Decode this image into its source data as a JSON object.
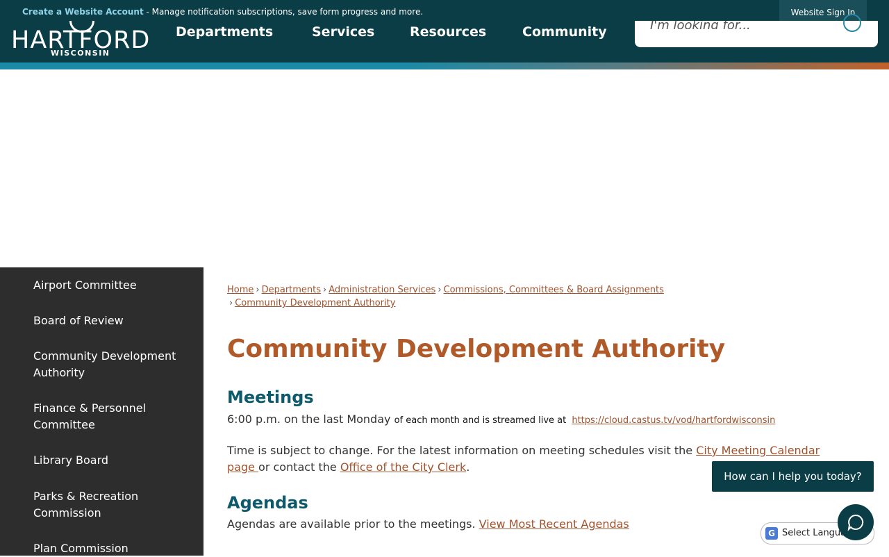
{
  "topbar": {
    "account_link": "Create a Website Account",
    "account_text": " - Manage notification subscriptions, save form progress and more.",
    "signin_label": "Website Sign In"
  },
  "logo": {
    "name": "HARTFORD",
    "state": "WISCONSIN"
  },
  "nav": {
    "items": [
      "Departments",
      "Services",
      "Resources",
      "Community"
    ]
  },
  "search": {
    "placeholder": "I'm looking for..."
  },
  "sidebar": {
    "items": [
      "Airport Committee",
      "Board of Review",
      "Community Development Authority",
      "Finance & Personnel Committee",
      "Library Board",
      "Parks & Recreation Commission",
      "Plan Commission"
    ]
  },
  "breadcrumb": {
    "items": [
      "Home",
      "Departments",
      "Administration Services",
      "Commissions, Committees & Board Assignments",
      "Community Development Authority"
    ],
    "separator": "›"
  },
  "page": {
    "title": "Community Development Authority",
    "meetings_heading": "Meetings",
    "meetings_time": "6:00 p.m. on the last Monday ",
    "meetings_stream": "of each month and is streamed live at ",
    "meetings_url": "https://cloud.castus.tv/vod/hartfordwisconsin",
    "change_text": "Time is subject to change.  For the latest information on meeting schedules visit the ",
    "calendar_link": "City Meeting Calendar page ",
    "contact_text": "or contact the ",
    "clerk_link": "Office of the City Clerk",
    "period": ".",
    "agendas_heading": "Agendas",
    "agendas_text": "Agendas are available prior to the meetings. ",
    "agendas_link": "View Most Recent Agendas"
  },
  "chat": {
    "prompt": "How can I help you today?"
  },
  "language": {
    "label": "Select Language"
  },
  "colors": {
    "header": "#0b3d47",
    "accent": "#b05a2a",
    "heading": "#0e5a6c",
    "sidebar": "#2d2d2d"
  }
}
